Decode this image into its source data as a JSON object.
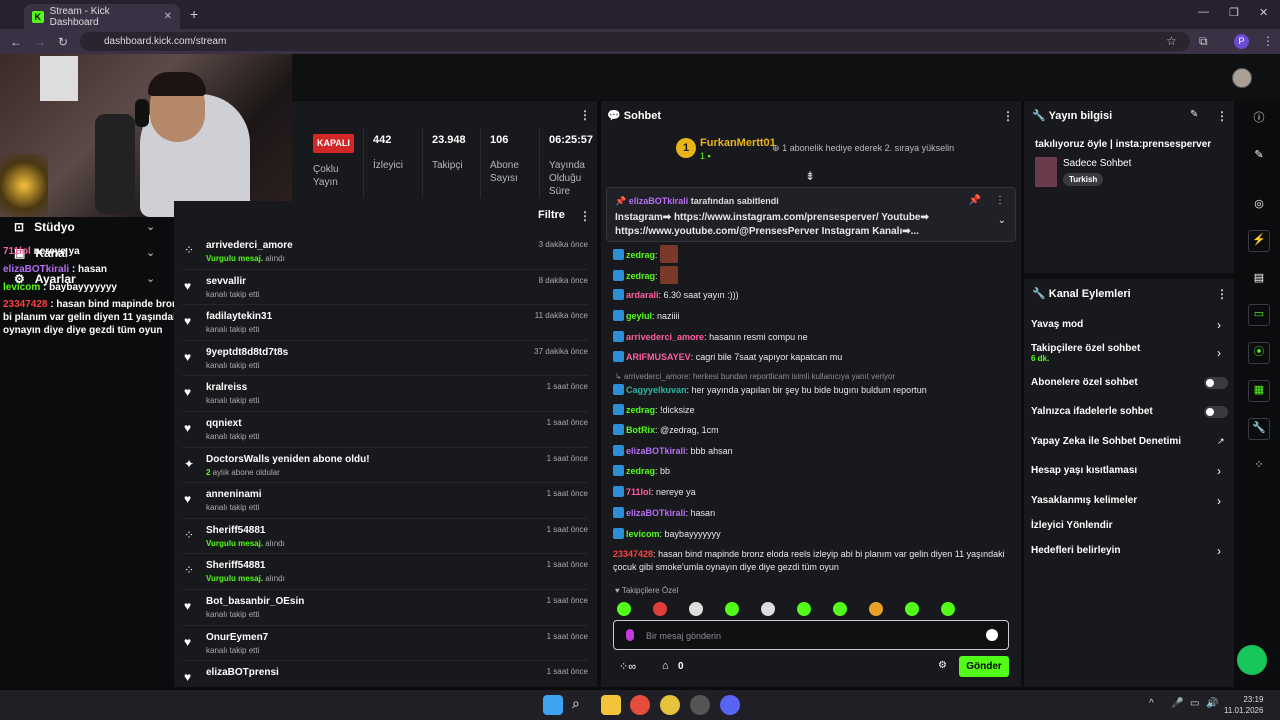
{
  "browser": {
    "tab_title": "Stream - Kick Dashboard",
    "url": "dashboard.kick.com/stream",
    "profile_initial": "P"
  },
  "left_panel": {
    "studio": "Stüdyo",
    "channel": "Kanal",
    "settings": "Ayarlar"
  },
  "webcam_overlay_chat": [
    {
      "user": "711lol",
      "text": " nereye ya"
    },
    {
      "user": "elizaBOTkirali",
      "text": " : hasan"
    },
    {
      "user": "levicom",
      "text": " : baybayyyyyyy"
    },
    {
      "user": "23347428",
      "text": " : hasan bind mapinde bronz eloda reels izleyip abi bi planım var gelin diyen 11 yaşındaki çocuk gibi smoke'umla oynayın diye diye gezdi tüm oyun"
    }
  ],
  "stats": {
    "status_badge": "KAPALI",
    "status_label": "Çoklu Yayın",
    "viewers_value": "442",
    "viewers_label": "İzleyici",
    "followers_value": "23.948",
    "followers_label": "Takipçi",
    "subs_value": "106",
    "subs_label": "Abone Sayısı",
    "uptime_value": "06:25:57",
    "uptime_label": "Yayında Olduğu Süre"
  },
  "activity": {
    "filter_label": "Filtre",
    "items": [
      {
        "name": "arrivederci_amore",
        "sub_hl": "Vurgulu mesaj.",
        "sub": " alındı",
        "time": "3 dakika önce",
        "icon": "gift-icon"
      },
      {
        "name": "sevvallir",
        "sub_hl": "",
        "sub": "kanalı takip etti",
        "time": "8 dakika önce",
        "icon": "heart-icon"
      },
      {
        "name": "fadilaytekin31",
        "sub_hl": "",
        "sub": "kanalı takip etti",
        "time": "11 dakika önce",
        "icon": "heart-icon"
      },
      {
        "name": "9yeptdt8d8td7t8s",
        "sub_hl": "",
        "sub": "kanalı takip etti",
        "time": "37 dakika önce",
        "icon": "heart-icon"
      },
      {
        "name": "kralreiss",
        "sub_hl": "",
        "sub": "kanalı takip etti",
        "time": "1 saat önce",
        "icon": "heart-icon"
      },
      {
        "name": "qqniext",
        "sub_hl": "",
        "sub": "kanalı takip etti",
        "time": "1 saat önce",
        "icon": "heart-icon"
      },
      {
        "name": "DoctorsWalls yeniden abone oldu!",
        "sub_hl": "2",
        "sub": " aylık abone oldular",
        "time": "1 saat önce",
        "icon": "sparkle-icon"
      },
      {
        "name": "anneninami",
        "sub_hl": "",
        "sub": "kanalı takip etti",
        "time": "1 saat önce",
        "icon": "heart-icon"
      },
      {
        "name": "Sheriff54881",
        "sub_hl": "Vurgulu mesaj.",
        "sub": " alındı",
        "time": "1 saat önce",
        "icon": "gift-icon"
      },
      {
        "name": "Sheriff54881",
        "sub_hl": "Vurgulu mesaj.",
        "sub": " alındı",
        "time": "1 saat önce",
        "icon": "gift-icon"
      },
      {
        "name": "Bot_basanbir_OEsin",
        "sub_hl": "",
        "sub": "kanalı takip etti",
        "time": "1 saat önce",
        "icon": "heart-icon"
      },
      {
        "name": "OnurEymen7",
        "sub_hl": "",
        "sub": "kanalı takip etti",
        "time": "1 saat önce",
        "icon": "heart-icon"
      },
      {
        "name": "elizaBOTprensi",
        "sub_hl": "",
        "sub": "",
        "time": "1 saat önce",
        "icon": "heart-icon"
      }
    ]
  },
  "chat": {
    "title": "Sohbet",
    "gift_user": "FurkanMertt01",
    "gift_count": "1",
    "gift_text": "1 abonelik hediye ederek 2. sıraya yükselin",
    "pinned_by": "elizaBOTkirali",
    "pinned_suffix": " tarafından sabitlendi",
    "pinned_text": "Instagram➡ https://www.instagram.com/prensesperver/ Youtube➡ https://www.youtube.com/@PrensesPerver Instagram Kanalı➡...",
    "messages": [
      {
        "user": "zedrag",
        "color": "#53fc18",
        "text": "",
        "emote": true
      },
      {
        "user": "zedrag",
        "color": "#53fc18",
        "text": "",
        "emote": true
      },
      {
        "user": "ardarali",
        "color": "#ff5ea3",
        "text": "6.30 saat yayın :)))"
      },
      {
        "user": "geylul",
        "color": "#53fc18",
        "text": "naziiii"
      },
      {
        "user": "arrivederci_amore",
        "color": "#ff5ea3",
        "text": "hasanın resmi compu ne"
      },
      {
        "user": "ARIFMUSAYEV",
        "color": "#ff5ea3",
        "text": "cagri bile 7saat yapıyor kapatcan mu"
      },
      {
        "user": "Cagyyelkuvan",
        "color": "#2cb5a6",
        "text": "her yayında yapılan bir şey bu bide bugını buldum reportun"
      },
      {
        "user": "zedrag",
        "color": "#53fc18",
        "text": "!dicksize"
      },
      {
        "user": "BotRix",
        "color": "#53fc18",
        "text": "@zedrag, 1cm"
      },
      {
        "user": "elizaBOTkirali",
        "color": "#b66ef2",
        "text": "bbb ahsan"
      },
      {
        "user": "zedrag",
        "color": "#53fc18",
        "text": "bb"
      },
      {
        "user": "711lol",
        "color": "#ff5ea3",
        "text": "nereye ya"
      },
      {
        "user": "elizaBOTkirali",
        "color": "#b66ef2",
        "text": "hasan"
      },
      {
        "user": "levicom",
        "color": "#53fc18",
        "text": "baybayyyyyyy"
      },
      {
        "user": "23347428",
        "color": "#ff4040",
        "text": "hasan bind mapinde bronz eloda reels izleyip abi bi planım var gelin diyen 11 yaşındaki çocuk gibi smoke'umla oynayın diye diye gezdi tüm oyun"
      }
    ],
    "reply_note": "arrivederci_amore: herkesi bundan reportlicam isimli kullanıcıya yanıt veriyor",
    "followers_only_label": "Takipçilere Özel",
    "input_placeholder": "Bir mesaj gönderin",
    "points": "0",
    "send_label": "Gönder"
  },
  "stream_info": {
    "title": "Yayın bilgisi",
    "stream_title": "takılıyoruz öyle | insta:prensesperver",
    "category": "Sadece Sohbet",
    "language": "Turkish"
  },
  "channel_actions": {
    "title": "Kanal Eylemleri",
    "items": [
      {
        "label": "Yavaş mod",
        "sub": "",
        "control": "chevron"
      },
      {
        "label": "Takipçilere özel sohbet",
        "sub": "6 dk.",
        "control": "chevron"
      },
      {
        "label": "Abonelere özel sohbet",
        "sub": "",
        "control": "toggle"
      },
      {
        "label": "Yalnızca ifadelerle sohbet",
        "sub": "",
        "control": "toggle"
      },
      {
        "label": "Yapay Zeka ile Sohbet Denetimi",
        "sub": "",
        "control": "external"
      },
      {
        "label": "Hesap yaşı kısıtlaması",
        "sub": "",
        "control": "chevron"
      },
      {
        "label": "Yasaklanmış kelimeler",
        "sub": "",
        "control": "chevron"
      },
      {
        "label": "İzleyici Yönlendir",
        "sub": "",
        "control": "none"
      },
      {
        "label": "Hedefleri belirleyin",
        "sub": "",
        "control": "chevron"
      }
    ]
  },
  "taskbar": {
    "time": "23:19",
    "date": "11.01.2026"
  }
}
